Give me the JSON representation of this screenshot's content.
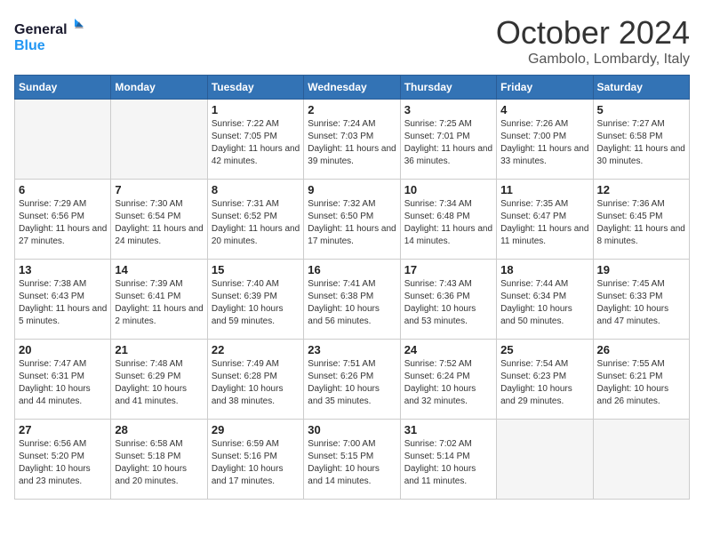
{
  "logo": {
    "line1": "General",
    "line2": "Blue"
  },
  "title": "October 2024",
  "location": "Gambolo, Lombardy, Italy",
  "days_of_week": [
    "Sunday",
    "Monday",
    "Tuesday",
    "Wednesday",
    "Thursday",
    "Friday",
    "Saturday"
  ],
  "weeks": [
    [
      {
        "day": "",
        "info": ""
      },
      {
        "day": "",
        "info": ""
      },
      {
        "day": "1",
        "info": "Sunrise: 7:22 AM\nSunset: 7:05 PM\nDaylight: 11 hours and 42 minutes."
      },
      {
        "day": "2",
        "info": "Sunrise: 7:24 AM\nSunset: 7:03 PM\nDaylight: 11 hours and 39 minutes."
      },
      {
        "day": "3",
        "info": "Sunrise: 7:25 AM\nSunset: 7:01 PM\nDaylight: 11 hours and 36 minutes."
      },
      {
        "day": "4",
        "info": "Sunrise: 7:26 AM\nSunset: 7:00 PM\nDaylight: 11 hours and 33 minutes."
      },
      {
        "day": "5",
        "info": "Sunrise: 7:27 AM\nSunset: 6:58 PM\nDaylight: 11 hours and 30 minutes."
      }
    ],
    [
      {
        "day": "6",
        "info": "Sunrise: 7:29 AM\nSunset: 6:56 PM\nDaylight: 11 hours and 27 minutes."
      },
      {
        "day": "7",
        "info": "Sunrise: 7:30 AM\nSunset: 6:54 PM\nDaylight: 11 hours and 24 minutes."
      },
      {
        "day": "8",
        "info": "Sunrise: 7:31 AM\nSunset: 6:52 PM\nDaylight: 11 hours and 20 minutes."
      },
      {
        "day": "9",
        "info": "Sunrise: 7:32 AM\nSunset: 6:50 PM\nDaylight: 11 hours and 17 minutes."
      },
      {
        "day": "10",
        "info": "Sunrise: 7:34 AM\nSunset: 6:48 PM\nDaylight: 11 hours and 14 minutes."
      },
      {
        "day": "11",
        "info": "Sunrise: 7:35 AM\nSunset: 6:47 PM\nDaylight: 11 hours and 11 minutes."
      },
      {
        "day": "12",
        "info": "Sunrise: 7:36 AM\nSunset: 6:45 PM\nDaylight: 11 hours and 8 minutes."
      }
    ],
    [
      {
        "day": "13",
        "info": "Sunrise: 7:38 AM\nSunset: 6:43 PM\nDaylight: 11 hours and 5 minutes."
      },
      {
        "day": "14",
        "info": "Sunrise: 7:39 AM\nSunset: 6:41 PM\nDaylight: 11 hours and 2 minutes."
      },
      {
        "day": "15",
        "info": "Sunrise: 7:40 AM\nSunset: 6:39 PM\nDaylight: 10 hours and 59 minutes."
      },
      {
        "day": "16",
        "info": "Sunrise: 7:41 AM\nSunset: 6:38 PM\nDaylight: 10 hours and 56 minutes."
      },
      {
        "day": "17",
        "info": "Sunrise: 7:43 AM\nSunset: 6:36 PM\nDaylight: 10 hours and 53 minutes."
      },
      {
        "day": "18",
        "info": "Sunrise: 7:44 AM\nSunset: 6:34 PM\nDaylight: 10 hours and 50 minutes."
      },
      {
        "day": "19",
        "info": "Sunrise: 7:45 AM\nSunset: 6:33 PM\nDaylight: 10 hours and 47 minutes."
      }
    ],
    [
      {
        "day": "20",
        "info": "Sunrise: 7:47 AM\nSunset: 6:31 PM\nDaylight: 10 hours and 44 minutes."
      },
      {
        "day": "21",
        "info": "Sunrise: 7:48 AM\nSunset: 6:29 PM\nDaylight: 10 hours and 41 minutes."
      },
      {
        "day": "22",
        "info": "Sunrise: 7:49 AM\nSunset: 6:28 PM\nDaylight: 10 hours and 38 minutes."
      },
      {
        "day": "23",
        "info": "Sunrise: 7:51 AM\nSunset: 6:26 PM\nDaylight: 10 hours and 35 minutes."
      },
      {
        "day": "24",
        "info": "Sunrise: 7:52 AM\nSunset: 6:24 PM\nDaylight: 10 hours and 32 minutes."
      },
      {
        "day": "25",
        "info": "Sunrise: 7:54 AM\nSunset: 6:23 PM\nDaylight: 10 hours and 29 minutes."
      },
      {
        "day": "26",
        "info": "Sunrise: 7:55 AM\nSunset: 6:21 PM\nDaylight: 10 hours and 26 minutes."
      }
    ],
    [
      {
        "day": "27",
        "info": "Sunrise: 6:56 AM\nSunset: 5:20 PM\nDaylight: 10 hours and 23 minutes."
      },
      {
        "day": "28",
        "info": "Sunrise: 6:58 AM\nSunset: 5:18 PM\nDaylight: 10 hours and 20 minutes."
      },
      {
        "day": "29",
        "info": "Sunrise: 6:59 AM\nSunset: 5:16 PM\nDaylight: 10 hours and 17 minutes."
      },
      {
        "day": "30",
        "info": "Sunrise: 7:00 AM\nSunset: 5:15 PM\nDaylight: 10 hours and 14 minutes."
      },
      {
        "day": "31",
        "info": "Sunrise: 7:02 AM\nSunset: 5:14 PM\nDaylight: 10 hours and 11 minutes."
      },
      {
        "day": "",
        "info": ""
      },
      {
        "day": "",
        "info": ""
      }
    ]
  ]
}
